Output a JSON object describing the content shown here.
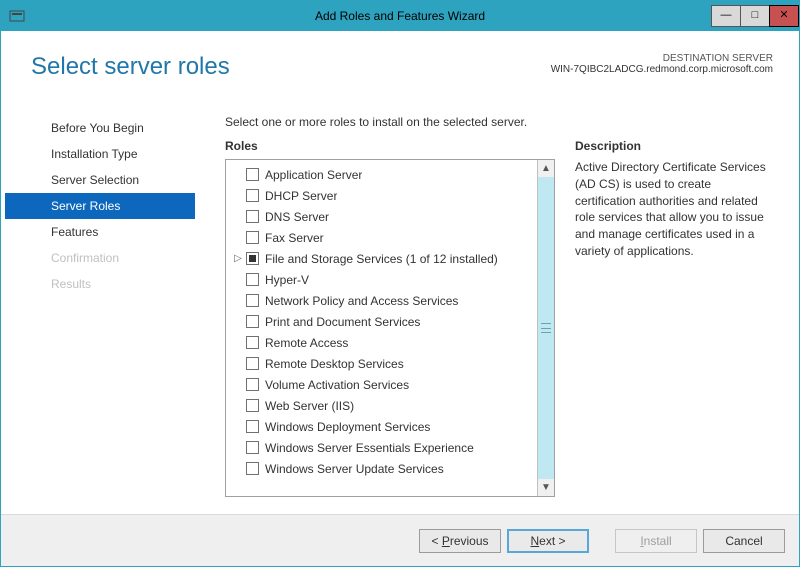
{
  "window": {
    "title": "Add Roles and Features Wizard"
  },
  "header": {
    "page_title": "Select server roles",
    "dest_label": "DESTINATION SERVER",
    "dest_server": "WIN-7QIBC2LADCG.redmond.corp.microsoft.com"
  },
  "nav": {
    "items": [
      {
        "label": "Before You Begin",
        "state": "normal"
      },
      {
        "label": "Installation Type",
        "state": "normal"
      },
      {
        "label": "Server Selection",
        "state": "normal"
      },
      {
        "label": "Server Roles",
        "state": "selected"
      },
      {
        "label": "Features",
        "state": "normal"
      },
      {
        "label": "Confirmation",
        "state": "disabled"
      },
      {
        "label": "Results",
        "state": "disabled"
      }
    ]
  },
  "main": {
    "instruction": "Select one or more roles to install on the selected server.",
    "roles_heading": "Roles",
    "desc_heading": "Description",
    "roles": [
      {
        "label": "Application Server",
        "checked": false,
        "expandable": false
      },
      {
        "label": "DHCP Server",
        "checked": false,
        "expandable": false
      },
      {
        "label": "DNS Server",
        "checked": false,
        "expandable": false
      },
      {
        "label": "Fax Server",
        "checked": false,
        "expandable": false
      },
      {
        "label": "File and Storage Services (1 of 12 installed)",
        "checked": "partial",
        "expandable": true
      },
      {
        "label": "Hyper-V",
        "checked": false,
        "expandable": false
      },
      {
        "label": "Network Policy and Access Services",
        "checked": false,
        "expandable": false
      },
      {
        "label": "Print and Document Services",
        "checked": false,
        "expandable": false
      },
      {
        "label": "Remote Access",
        "checked": false,
        "expandable": false
      },
      {
        "label": "Remote Desktop Services",
        "checked": false,
        "expandable": false
      },
      {
        "label": "Volume Activation Services",
        "checked": false,
        "expandable": false
      },
      {
        "label": "Web Server (IIS)",
        "checked": false,
        "expandable": false
      },
      {
        "label": "Windows Deployment Services",
        "checked": false,
        "expandable": false
      },
      {
        "label": "Windows Server Essentials Experience",
        "checked": false,
        "expandable": false
      },
      {
        "label": "Windows Server Update Services",
        "checked": false,
        "expandable": false
      }
    ],
    "description": "Active Directory Certificate Services (AD CS) is used to create certification authorities and related role services that allow you to issue and manage certificates used in a variety of applications."
  },
  "footer": {
    "previous_prefix": "< ",
    "previous_u": "P",
    "previous_rest": "revious",
    "next_u": "N",
    "next_rest": "ext >",
    "install_u": "I",
    "install_rest": "nstall",
    "cancel": "Cancel"
  }
}
